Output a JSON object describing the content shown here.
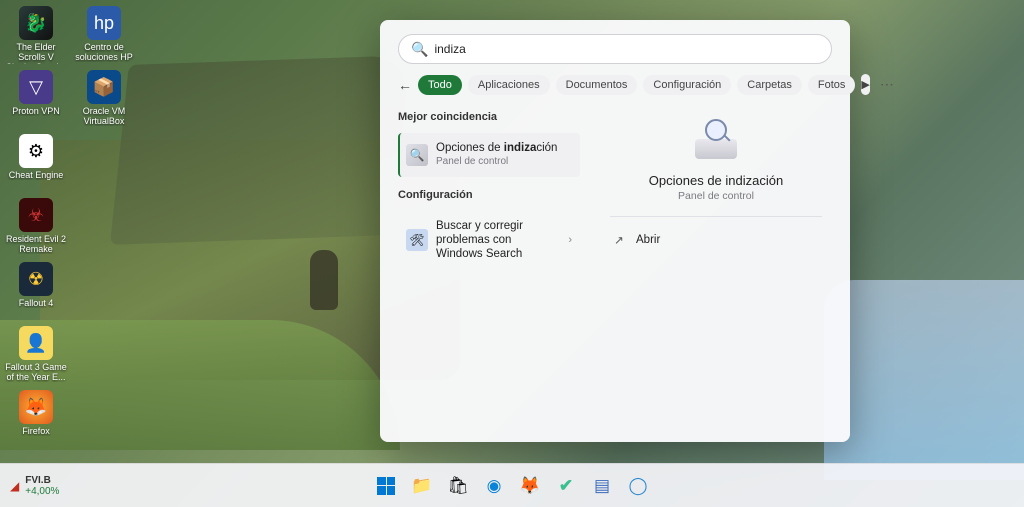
{
  "search": {
    "value": "indiza",
    "placeholder": ""
  },
  "tabs": {
    "todo": "Todo",
    "aplicaciones": "Aplicaciones",
    "documentos": "Documentos",
    "configuracion": "Configuración",
    "carpetas": "Carpetas",
    "fotos": "Fotos"
  },
  "left": {
    "best_match": "Mejor coincidencia",
    "config_section": "Configuración",
    "result1_pre": "Opciones de ",
    "result1_hl": "indiza",
    "result1_post": "ción",
    "result1_sub": "Panel de control",
    "result2": "Buscar y corregir problemas con Windows Search"
  },
  "right": {
    "title": "Opciones de indización",
    "sub": "Panel de control",
    "open": "Abrir"
  },
  "desktop": {
    "i0": "The Elder Scrolls V Skyrim Speci...",
    "i1": "Centro de soluciones HP",
    "i2": "Proton VPN",
    "i3": "Oracle VM VirtualBox",
    "i4": "Cheat Engine",
    "i5": "Resident Evil 2 Remake",
    "i6": "Fallout 4",
    "i7": "Fallout 3 Game of the Year E...",
    "i8": "Firefox"
  },
  "taskbar": {
    "symbol": "FVI.B",
    "change": "+4,00%"
  }
}
